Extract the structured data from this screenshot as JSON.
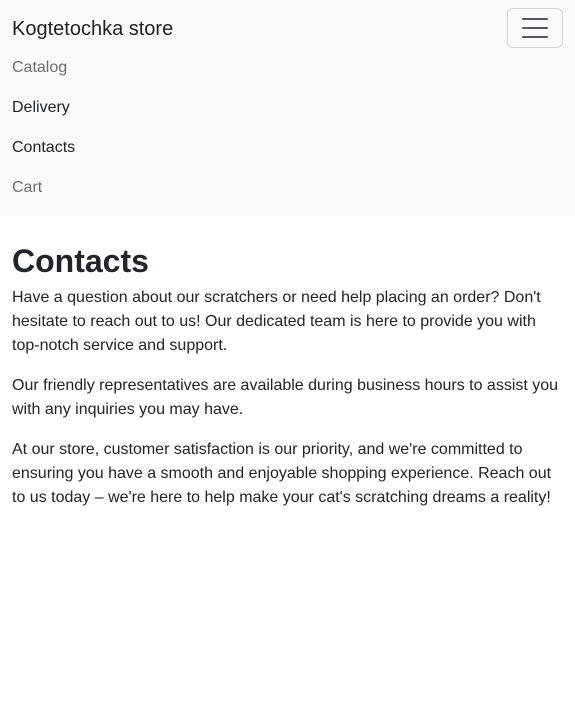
{
  "navbar": {
    "brand": "Kogtetochka store",
    "toggler_icon": "hamburger-menu-icon",
    "items": [
      {
        "label": "Catalog"
      },
      {
        "label": "Delivery"
      },
      {
        "label": "Contacts"
      },
      {
        "label": "Cart"
      }
    ]
  },
  "main": {
    "title": "Contacts",
    "paragraphs": [
      "Have a question about our scratchers or need help placing an order? Don't hesitate to reach out to us! Our dedicated team is here to provide you with top-notch service and support.",
      "Our friendly representatives are available during business hours to assist you with any inquiries you may have.",
      "At our store, customer satisfaction is our priority, and we're committed to ensuring you have a smooth and enjoyable shopping experience. Reach out to us today – we're here to help make your cat's scratching dreams a reality!"
    ]
  },
  "colors": {
    "navbar_bg": "#f8f9fa",
    "text": "#212529",
    "muted_link": "#6c6f72"
  }
}
